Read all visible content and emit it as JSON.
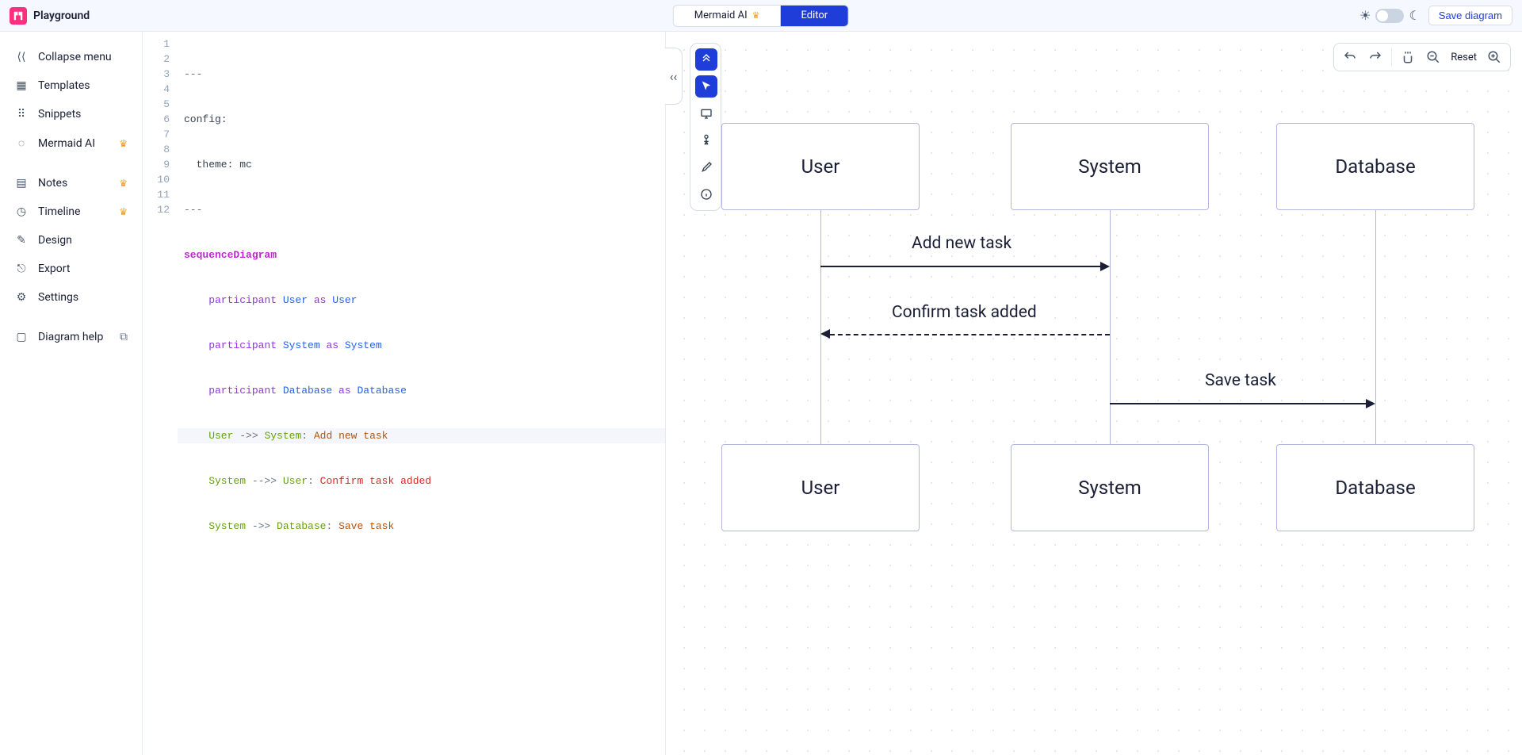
{
  "header": {
    "title": "Playground",
    "tab_ai": "Mermaid AI",
    "tab_editor": "Editor",
    "save": "Save diagram"
  },
  "sidebar": {
    "collapse": "Collapse menu",
    "templates": "Templates",
    "snippets": "Snippets",
    "mermaid_ai": "Mermaid AI",
    "notes": "Notes",
    "timeline": "Timeline",
    "design": "Design",
    "export": "Export",
    "settings": "Settings",
    "help": "Diagram help"
  },
  "controls": {
    "reset": "Reset"
  },
  "code": {
    "l1": "---",
    "l2": "config:",
    "l3": "  theme: mc",
    "l4": "---",
    "l5": "sequenceDiagram",
    "l6_a": "    participant ",
    "l6_b": "User",
    "l6_c": " as ",
    "l6_d": "User",
    "l7_a": "    participant ",
    "l7_b": "System",
    "l7_c": " as ",
    "l7_d": "System",
    "l8_a": "    participant ",
    "l8_b": "Database",
    "l8_c": " as ",
    "l8_d": "Database",
    "l9_a": "    User ",
    "l9_b": "->> ",
    "l9_c": "System",
    "l9_d": ": ",
    "l9_e": "Add new task",
    "l10_a": "    System ",
    "l10_b": "-->> ",
    "l10_c": "User",
    "l10_d": ": ",
    "l10_e": "Confirm task added",
    "l11_a": "    System ",
    "l11_b": "->> ",
    "l11_c": "Database",
    "l11_d": ": ",
    "l11_e": "Save task"
  },
  "gutter": [
    "1",
    "2",
    "3",
    "4",
    "5",
    "6",
    "7",
    "8",
    "9",
    "10",
    "11",
    "12"
  ],
  "diagram": {
    "actors": [
      "User",
      "System",
      "Database"
    ],
    "messages": {
      "m1": "Add new task",
      "m2": "Confirm task added",
      "m3": "Save task"
    }
  },
  "chart_data": {
    "type": "sequence_diagram",
    "participants": [
      "User",
      "System",
      "Database"
    ],
    "messages": [
      {
        "from": "User",
        "to": "System",
        "label": "Add new task",
        "style": "solid"
      },
      {
        "from": "System",
        "to": "User",
        "label": "Confirm task added",
        "style": "dashed"
      },
      {
        "from": "System",
        "to": "Database",
        "label": "Save task",
        "style": "solid"
      }
    ]
  }
}
